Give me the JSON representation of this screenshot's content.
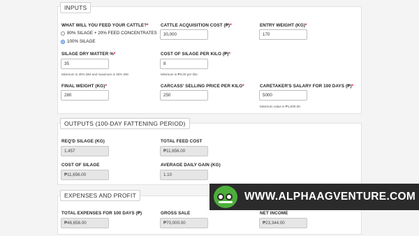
{
  "inputs": {
    "title": "INPUTS",
    "feed": {
      "label": "WHAT WILL YOU FEED YOUR CATTLE?",
      "options": [
        "80% SILAGE + 20% FEED CONCENTRATES",
        "100% SILAGE"
      ],
      "selected": "100% SILAGE"
    },
    "acq_cost": {
      "label": "CATTLE ACQUISITION COST (₱)",
      "value": "30,000"
    },
    "entry_weight": {
      "label": "ENTRY WEIGHT (KG)",
      "value": "170"
    },
    "dry_matter": {
      "label": "SILAGE DRY MATTER %",
      "value": "35",
      "hint": "Minimum is 30% DM and maximum is 45% DM"
    },
    "silage_cost": {
      "label": "COST OF SILAGE PER KILO (₱)",
      "value": "8",
      "hint": "Minimum is ₱3.00 per kilo."
    },
    "final_weight": {
      "label": "FINAL WEIGHT (KG)",
      "value": "280"
    },
    "selling_price": {
      "label": "CARCASS' SELLING PRICE PER KILO",
      "value": "250"
    },
    "caretaker": {
      "label": "CARETAKER'S SALARY FOR 100 DAYS (₱)",
      "value": "5000",
      "hint": "Minimum value is ₱1,000.00."
    },
    "required_mark": "*"
  },
  "outputs": {
    "title": "OUTPUTS (100-DAY FATTENING PERIOD)",
    "reqd_silage": {
      "label": "REQ'D SILAGE (KG)",
      "value": "1,457"
    },
    "total_feed": {
      "label": "TOTAL FEED COST",
      "value": "₱11,656.00"
    },
    "cost_silage": {
      "label": "COST OF SILAGE",
      "value": "₱11,656.00"
    },
    "adg": {
      "label": "AVERAGE DAILY GAIN (KG)",
      "value": "1.10"
    }
  },
  "expenses": {
    "title": "EXPENSES AND PROFIT",
    "total_expenses": {
      "label": "TOTAL EXPENSES FOR 100 DAYS (₱)",
      "value": "₱46,656.00"
    },
    "gross_sale": {
      "label": "GROSS SALE",
      "value": "₱70,000.00"
    },
    "net_income": {
      "label": "NET INCOME",
      "value": "₱23,344.00"
    }
  },
  "banner": {
    "text": "WWW.ALPHAAGVENTURE.COM",
    "logo_color": "#4caf3a",
    "bg_color": "#2b2b2b"
  },
  "colors": {
    "required": "#d0021b",
    "radio_accent": "#2a6fd6"
  }
}
